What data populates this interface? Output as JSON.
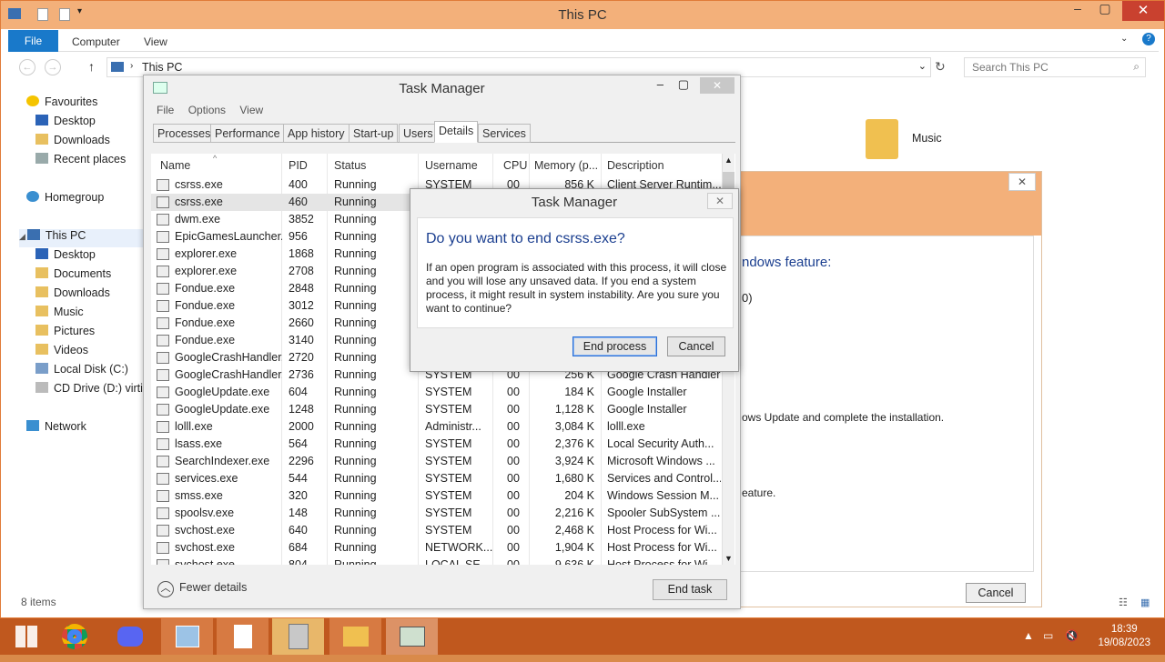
{
  "explorer": {
    "title": "This PC",
    "ribbon": {
      "file": "File",
      "computer": "Computer",
      "view": "View"
    },
    "address": "This PC",
    "search_placeholder": "Search This PC",
    "nav": [
      "Favourites",
      "Desktop",
      "Downloads",
      "Recent places",
      "Homegroup",
      "This PC",
      "Desktop",
      "Documents",
      "Downloads",
      "Music",
      "Pictures",
      "Videos",
      "Local Disk (C:)",
      "CD Drive (D:) virtio",
      "Network"
    ],
    "status": "8 items",
    "music": "Music",
    "bg_text": {
      "a": "ndows feature:",
      "b": "0)",
      "c": "ows Update and complete the installation.",
      "d": "eature.",
      "cancel": "Cancel"
    }
  },
  "taskmanager": {
    "title": "Task Manager",
    "menu": [
      "File",
      "Options",
      "View"
    ],
    "tabs": [
      "Processes",
      "Performance",
      "App history",
      "Start-up",
      "Users",
      "Details",
      "Services"
    ],
    "columns": [
      "Name",
      "PID",
      "Status",
      "Username",
      "CPU",
      "Memory (p...",
      "Description"
    ],
    "rows": [
      [
        "csrss.exe",
        "400",
        "Running",
        "SYSTEM",
        "00",
        "856 K",
        "Client Server Runtim..."
      ],
      [
        "csrss.exe",
        "460",
        "Running",
        "",
        "",
        "",
        ""
      ],
      [
        "dwm.exe",
        "3852",
        "Running",
        "",
        "",
        "",
        ""
      ],
      [
        "EpicGamesLauncher....",
        "956",
        "Running",
        "",
        "",
        "",
        ""
      ],
      [
        "explorer.exe",
        "1868",
        "Running",
        "",
        "",
        "",
        ""
      ],
      [
        "explorer.exe",
        "2708",
        "Running",
        "",
        "",
        "",
        ""
      ],
      [
        "Fondue.exe",
        "2848",
        "Running",
        "",
        "",
        "",
        ""
      ],
      [
        "Fondue.exe",
        "3012",
        "Running",
        "",
        "",
        "",
        ""
      ],
      [
        "Fondue.exe",
        "2660",
        "Running",
        "",
        "",
        "",
        ""
      ],
      [
        "Fondue.exe",
        "3140",
        "Running",
        "",
        "",
        "",
        ""
      ],
      [
        "GoogleCrashHandler....",
        "2720",
        "Running",
        "",
        "",
        "",
        ""
      ],
      [
        "GoogleCrashHandler....",
        "2736",
        "Running",
        "SYSTEM",
        "00",
        "256 K",
        "Google Crash Handler"
      ],
      [
        "GoogleUpdate.exe",
        "604",
        "Running",
        "SYSTEM",
        "00",
        "184 K",
        "Google Installer"
      ],
      [
        "GoogleUpdate.exe",
        "1248",
        "Running",
        "SYSTEM",
        "00",
        "1,128 K",
        "Google Installer"
      ],
      [
        "lolll.exe",
        "2000",
        "Running",
        "Administr...",
        "00",
        "3,084 K",
        "lolll.exe"
      ],
      [
        "lsass.exe",
        "564",
        "Running",
        "SYSTEM",
        "00",
        "2,376 K",
        "Local Security Auth..."
      ],
      [
        "SearchIndexer.exe",
        "2296",
        "Running",
        "SYSTEM",
        "00",
        "3,924 K",
        "Microsoft Windows ..."
      ],
      [
        "services.exe",
        "544",
        "Running",
        "SYSTEM",
        "00",
        "1,680 K",
        "Services and Control..."
      ],
      [
        "smss.exe",
        "320",
        "Running",
        "SYSTEM",
        "00",
        "204 K",
        "Windows Session M..."
      ],
      [
        "spoolsv.exe",
        "148",
        "Running",
        "SYSTEM",
        "00",
        "2,216 K",
        "Spooler SubSystem ..."
      ],
      [
        "svchost.exe",
        "640",
        "Running",
        "SYSTEM",
        "00",
        "2,468 K",
        "Host Process for Wi..."
      ],
      [
        "svchost.exe",
        "684",
        "Running",
        "NETWORK...",
        "00",
        "1,904 K",
        "Host Process for Wi..."
      ],
      [
        "svchost.exe",
        "804",
        "Running",
        "LOCAL SE...",
        "00",
        "9,636 K",
        "Host Process for Wi..."
      ]
    ],
    "fewer_details": "Fewer details",
    "end_task": "End task"
  },
  "dialog": {
    "title": "Task Manager",
    "question": "Do you want to end csrss.exe?",
    "message": "If an open program is associated with this process, it will close and you will lose any unsaved data. If you end a system process, it might result in system instability. Are you sure you want to continue?",
    "end_process": "End process",
    "cancel": "Cancel"
  },
  "taskbar": {
    "time": "18:39",
    "date": "19/08/2023"
  },
  "colors": {
    "accent": "#1979ca",
    "taskbar": "#c0581e",
    "titlebar": "#f3b07a"
  }
}
